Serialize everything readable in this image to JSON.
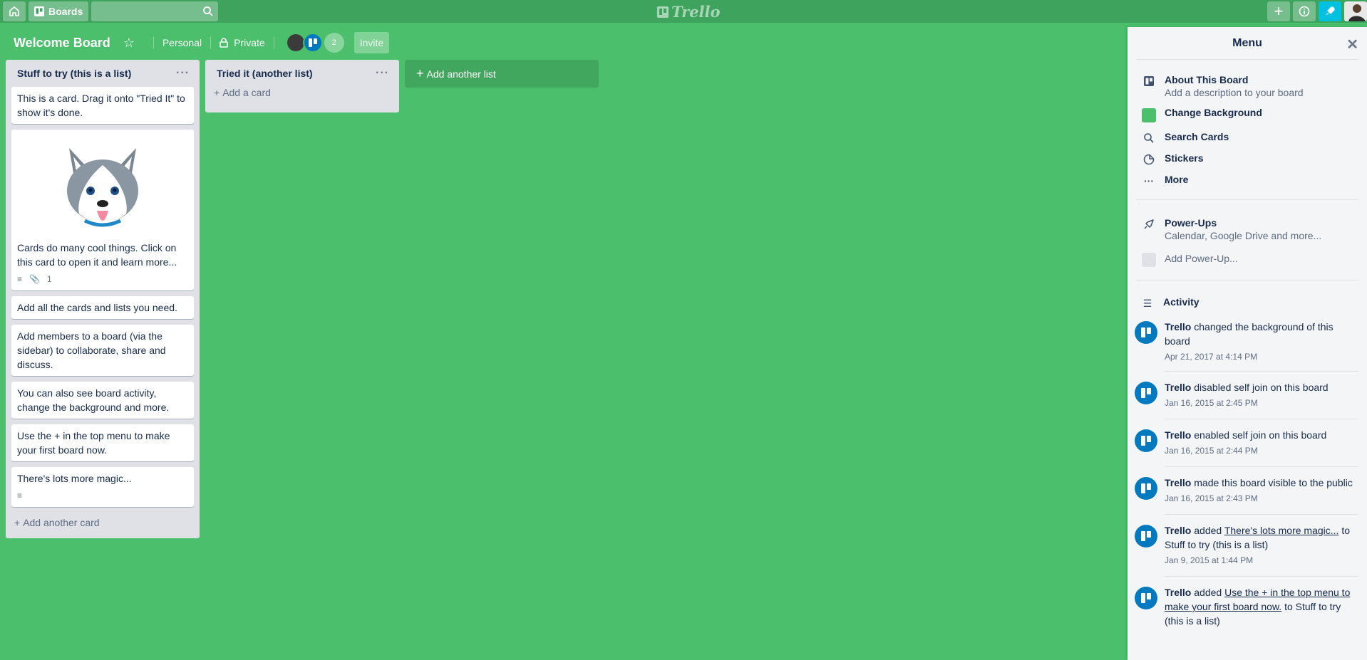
{
  "header": {
    "boards_label": "Boards",
    "logo_text": "Trello"
  },
  "board": {
    "title": "Welcome Board",
    "team": "Personal",
    "visibility": "Private",
    "member_count": "2",
    "invite_label": "Invite"
  },
  "lists": [
    {
      "title": "Stuff to try (this is a list)",
      "cards": [
        {
          "text": "This is a card. Drag it onto \"Tried It\" to show it's done."
        },
        {
          "text": "Cards do many cool things. Click on this card to open it and learn more...",
          "attachments": "1"
        },
        {
          "text": "Add all the cards and lists you need."
        },
        {
          "text": "Add members to a board (via the sidebar) to collaborate, share and discuss."
        },
        {
          "text": "You can also see board activity, change the background and more."
        },
        {
          "text": "Use the + in the top menu to make your first board now."
        },
        {
          "text": "There's lots more magic..."
        }
      ],
      "add_card": "Add another card"
    },
    {
      "title": "Tried it (another list)",
      "cards": [],
      "add_card": "Add a card"
    }
  ],
  "add_list_label": "Add another list",
  "menu": {
    "title": "Menu",
    "about_title": "About This Board",
    "about_desc": "Add a description to your board",
    "change_bg": "Change Background",
    "bg_color": "#4bbf6b",
    "search_cards": "Search Cards",
    "stickers": "Stickers",
    "more": "More",
    "powerups_title": "Power-Ups",
    "powerups_desc": "Calendar, Google Drive and more...",
    "add_powerup": "Add Power-Up...",
    "activity_title": "Activity",
    "activity": [
      {
        "actor": "Trello",
        "text": " changed the background of this board",
        "when": "Apr 21, 2017 at 4:14 PM"
      },
      {
        "actor": "Trello",
        "text": " disabled self join on this board",
        "when": "Jan 16, 2015 at 2:45 PM"
      },
      {
        "actor": "Trello",
        "text": " enabled self join on this board",
        "when": "Jan 16, 2015 at 2:44 PM"
      },
      {
        "actor": "Trello",
        "text": " made this board visible to the public",
        "when": "Jan 16, 2015 at 2:43 PM"
      },
      {
        "actor": "Trello",
        "pre": " added ",
        "link": "There's lots more magic...",
        "post": " to Stuff to try (this is a list)",
        "when": "Jan 9, 2015 at 1:44 PM"
      },
      {
        "actor": "Trello",
        "pre": " added ",
        "link": "Use the + in the top menu to make your first board now.",
        "post": " to Stuff to try (this is a list)",
        "when": ""
      }
    ]
  }
}
